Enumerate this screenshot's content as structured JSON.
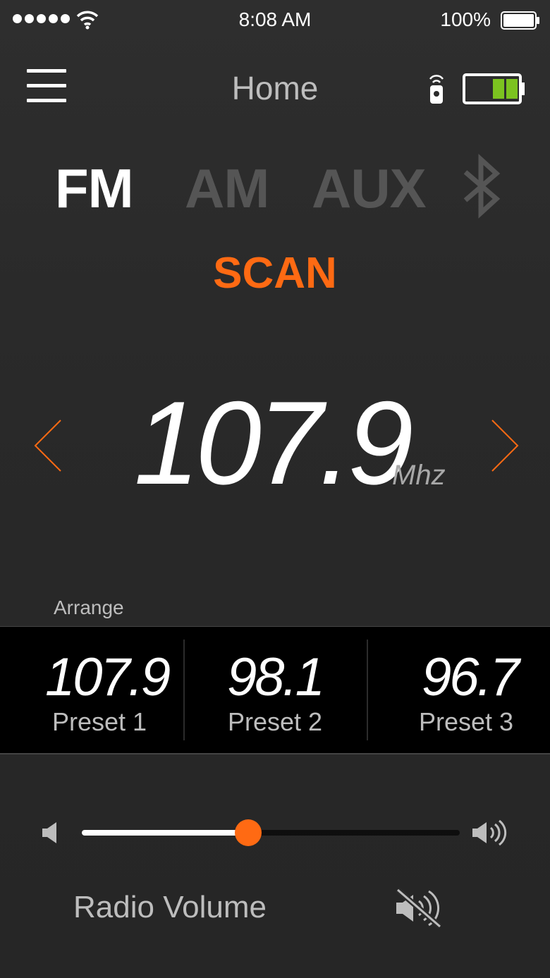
{
  "status_bar": {
    "time": "8:08 AM",
    "battery_percent": "100%",
    "signal_icon": "signal-dots-icon",
    "wifi_icon": "wifi-icon",
    "battery_icon": "battery-icon"
  },
  "nav": {
    "title": "Home",
    "menu_icon": "hamburger-menu-icon",
    "remote_icon": "remote-control-icon",
    "device_battery_icon": "device-battery-icon",
    "device_battery_level": 0.5
  },
  "sources": {
    "tabs": [
      {
        "label": "FM",
        "active": true
      },
      {
        "label": "AM",
        "active": false
      },
      {
        "label": "AUX",
        "active": false
      }
    ],
    "bluetooth_icon": "bluetooth-icon"
  },
  "scan_label": "SCAN",
  "tuner": {
    "frequency": "107.9",
    "unit": "Mhz"
  },
  "presets": {
    "arrange_label": "Arrange",
    "items": [
      {
        "value": "107.9",
        "label": "Preset 1"
      },
      {
        "value": "98.1",
        "label": "Preset 2"
      },
      {
        "value": "96.7",
        "label": "Preset 3"
      }
    ]
  },
  "volume": {
    "label": "Radio Volume",
    "level": 0.44
  },
  "colors": {
    "accent": "#ff6a13",
    "background": "#2b2b2b",
    "inactive_text": "#555555",
    "battery_green": "#7cc320"
  }
}
